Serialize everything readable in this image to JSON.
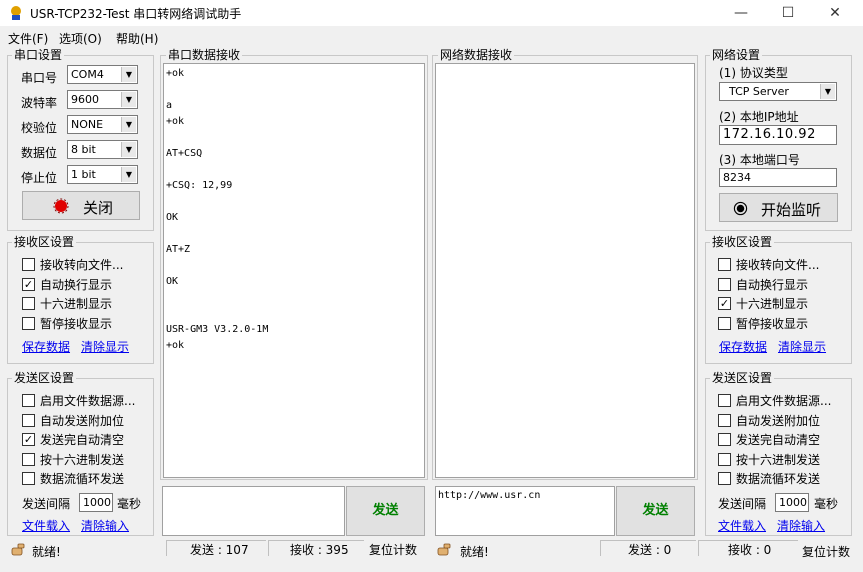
{
  "window": {
    "title": "USR-TCP232-Test 串口转网络调试助手",
    "minimize": "—",
    "maximize": "☐",
    "close": "✕"
  },
  "menu": [
    "文件(F)",
    "选项(O)",
    "帮助(H)"
  ],
  "serial": {
    "group_title": "串口设置",
    "port_label": "串口号",
    "port_value": "COM4",
    "baud_label": "波特率",
    "baud_value": "9600",
    "parity_label": "校验位",
    "parity_value": "NONE",
    "data_label": "数据位",
    "data_value": "8 bit",
    "stop_label": "停止位",
    "stop_value": "1 bit",
    "close_button": "关闭"
  },
  "serial_rx": {
    "group_title": "接收区设置",
    "options": [
      {
        "label": "接收转向文件...",
        "checked": false
      },
      {
        "label": "自动换行显示",
        "checked": true
      },
      {
        "label": "十六进制显示",
        "checked": false
      },
      {
        "label": "暂停接收显示",
        "checked": false
      }
    ],
    "save_link": "保存数据",
    "clear_link": "清除显示"
  },
  "serial_tx": {
    "group_title": "发送区设置",
    "options": [
      {
        "label": "启用文件数据源...",
        "checked": false
      },
      {
        "label": "自动发送附加位",
        "checked": false
      },
      {
        "label": "发送完自动清空",
        "checked": true
      },
      {
        "label": "按十六进制发送",
        "checked": false
      },
      {
        "label": "数据流循环发送",
        "checked": false
      }
    ],
    "interval_label": "发送间隔",
    "interval_value": "1000",
    "interval_unit": "毫秒",
    "load_link": "文件载入",
    "clear_link": "清除输入"
  },
  "serial_data": {
    "group_title": "串口数据接收",
    "lines": [
      "+ok",
      "",
      "a",
      "+ok",
      "",
      "AT+CSQ",
      "",
      "+CSQ: 12,99",
      "",
      "OK",
      "",
      "AT+Z",
      "",
      "OK",
      "",
      "",
      "USR-GM3 V3.2.0-1M",
      "+ok"
    ],
    "send_input": "",
    "send_button": "发送"
  },
  "net_data": {
    "group_title": "网络数据接收",
    "send_input": "http://www.usr.cn",
    "send_button": "发送"
  },
  "network": {
    "group_title": "网络设置",
    "protocol_label": "(1) 协议类型",
    "protocol_value": "TCP Server",
    "ip_label": "(2) 本地IP地址",
    "ip_value": "172.16.10.92",
    "port_label": "(3) 本地端口号",
    "port_value": "8234",
    "listen_button": "开始监听"
  },
  "net_rx": {
    "group_title": "接收区设置",
    "options": [
      {
        "label": "接收转向文件...",
        "checked": false
      },
      {
        "label": "自动换行显示",
        "checked": false
      },
      {
        "label": "十六进制显示",
        "checked": true
      },
      {
        "label": "暂停接收显示",
        "checked": false
      }
    ],
    "save_link": "保存数据",
    "clear_link": "清除显示"
  },
  "net_tx": {
    "group_title": "发送区设置",
    "options": [
      {
        "label": "启用文件数据源...",
        "checked": false
      },
      {
        "label": "自动发送附加位",
        "checked": false
      },
      {
        "label": "发送完自动清空",
        "checked": false
      },
      {
        "label": "按十六进制发送",
        "checked": false
      },
      {
        "label": "数据流循环发送",
        "checked": false
      }
    ],
    "interval_label": "发送间隔",
    "interval_value": "1000",
    "interval_unit": "毫秒",
    "load_link": "文件载入",
    "clear_link": "清除输入"
  },
  "status_left": {
    "ready": "就绪!",
    "sent": "发送 : 107",
    "received": "接收 : 395",
    "reset": "复位计数"
  },
  "status_right": {
    "ready": "就绪!",
    "sent": "发送 : 0",
    "received": "接收 : 0",
    "reset": "复位计数"
  },
  "colors": {
    "accent": "#e00000",
    "link": "#0000ee",
    "send_text": "#008000"
  }
}
